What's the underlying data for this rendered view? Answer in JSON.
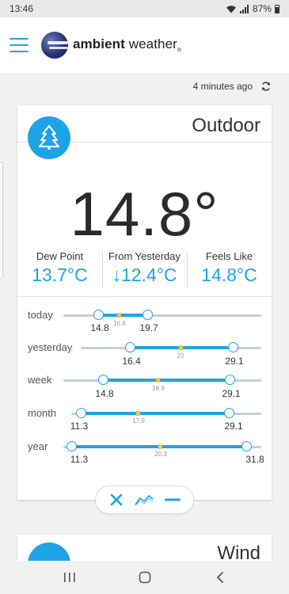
{
  "status_bar": {
    "time": "13:46",
    "battery": "87%"
  },
  "app": {
    "brand_bold": "ambient",
    "brand_light": "weather",
    "registered": "®"
  },
  "updated": {
    "text": "4 minutes ago"
  },
  "outdoor": {
    "title": "Outdoor",
    "icon": "tree-icon",
    "temperature": "14.8°",
    "stats": [
      {
        "label": "Dew Point",
        "value": "13.7°C"
      },
      {
        "label": "From Yesterday",
        "value": "↓12.4°C"
      },
      {
        "label": "Feels Like",
        "value": "14.8°C"
      }
    ],
    "ranges": [
      {
        "label": "today",
        "min_label": "14.8",
        "max_label": "19.7",
        "avg_label": "16.8"
      },
      {
        "label": "yesterday",
        "min_label": "16.4",
        "max_label": "29.1",
        "avg_label": "20"
      },
      {
        "label": "week",
        "min_label": "14.8",
        "max_label": "29.1",
        "avg_label": "18.9"
      },
      {
        "label": "month",
        "min_label": "11.3",
        "max_label": "29.1",
        "avg_label": "17.9"
      },
      {
        "label": "year",
        "min_label": "11.3",
        "max_label": "31.8",
        "avg_label": "20.3"
      }
    ]
  },
  "toggle": {
    "icons": [
      "close-icon",
      "line-chart-icon",
      "minus-icon"
    ]
  },
  "wind": {
    "title": "Wind",
    "icon": "wind-icon"
  },
  "colors": {
    "accent": "#1ea3e6",
    "avg_marker": "#f4c542",
    "track": "#c8ced3"
  }
}
